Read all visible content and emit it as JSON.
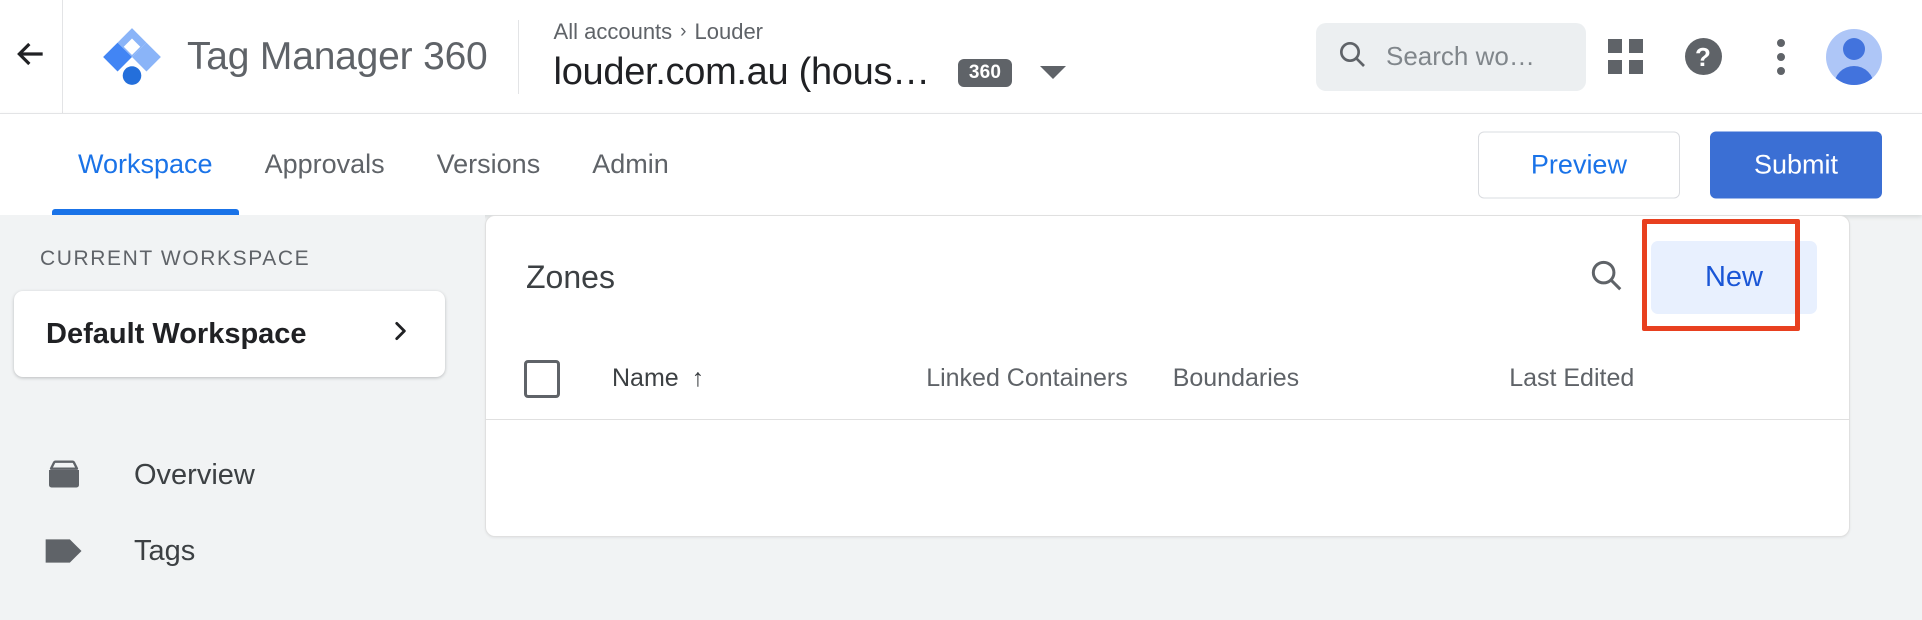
{
  "topbar": {
    "back_icon": "arrow-back-icon",
    "logo_icon": "tag-manager-logo",
    "product_title": "Tag Manager 360",
    "breadcrumb": {
      "root": "All accounts",
      "separator": "›",
      "account": "Louder"
    },
    "container_name": "louder.com.au (hous…",
    "container_badge": "360",
    "container_dropdown_icon": "caret-down-icon",
    "search": {
      "icon": "search-icon",
      "placeholder": "Search wo…"
    },
    "apps_icon": "apps-grid-icon",
    "help_icon": "help-icon",
    "help_glyph": "?",
    "more_icon": "more-vert-icon",
    "avatar_icon": "account-avatar"
  },
  "nav": {
    "tabs": [
      {
        "label": "Workspace",
        "active": true
      },
      {
        "label": "Approvals",
        "active": false
      },
      {
        "label": "Versions",
        "active": false
      },
      {
        "label": "Admin",
        "active": false
      }
    ],
    "preview_label": "Preview",
    "submit_label": "Submit",
    "dot_columns": [
      [
        true,
        true,
        true
      ],
      [
        true,
        false,
        true
      ],
      [
        true,
        true,
        true
      ]
    ],
    "dot_color": "#3875c4"
  },
  "sidebar": {
    "section_label": "CURRENT WORKSPACE",
    "workspace_name": "Default Workspace",
    "workspace_chevron_icon": "chevron-right-icon",
    "items": [
      {
        "label": "Overview",
        "icon": "overview-box-icon"
      },
      {
        "label": "Tags",
        "icon": "tag-icon"
      }
    ]
  },
  "main": {
    "card_title": "Zones",
    "search_icon": "search-icon",
    "new_button_label": "New",
    "annotation_color": "#e8401f",
    "table": {
      "select_all_checkbox": "select-all-checkbox",
      "columns": [
        {
          "label": "Name",
          "sorted": true,
          "sort_icon": "↑"
        },
        {
          "label": "Linked Containers",
          "sorted": false
        },
        {
          "label": "Boundaries",
          "sorted": false
        },
        {
          "label": "Last Edited",
          "sorted": false
        }
      ],
      "rows": []
    }
  },
  "colors": {
    "accent_blue": "#1a73e8",
    "submit_blue": "#3b6fd4",
    "new_button_bg": "#e8f0fe",
    "page_bg": "#f1f3f4",
    "badge_grey": "#5f6368"
  }
}
